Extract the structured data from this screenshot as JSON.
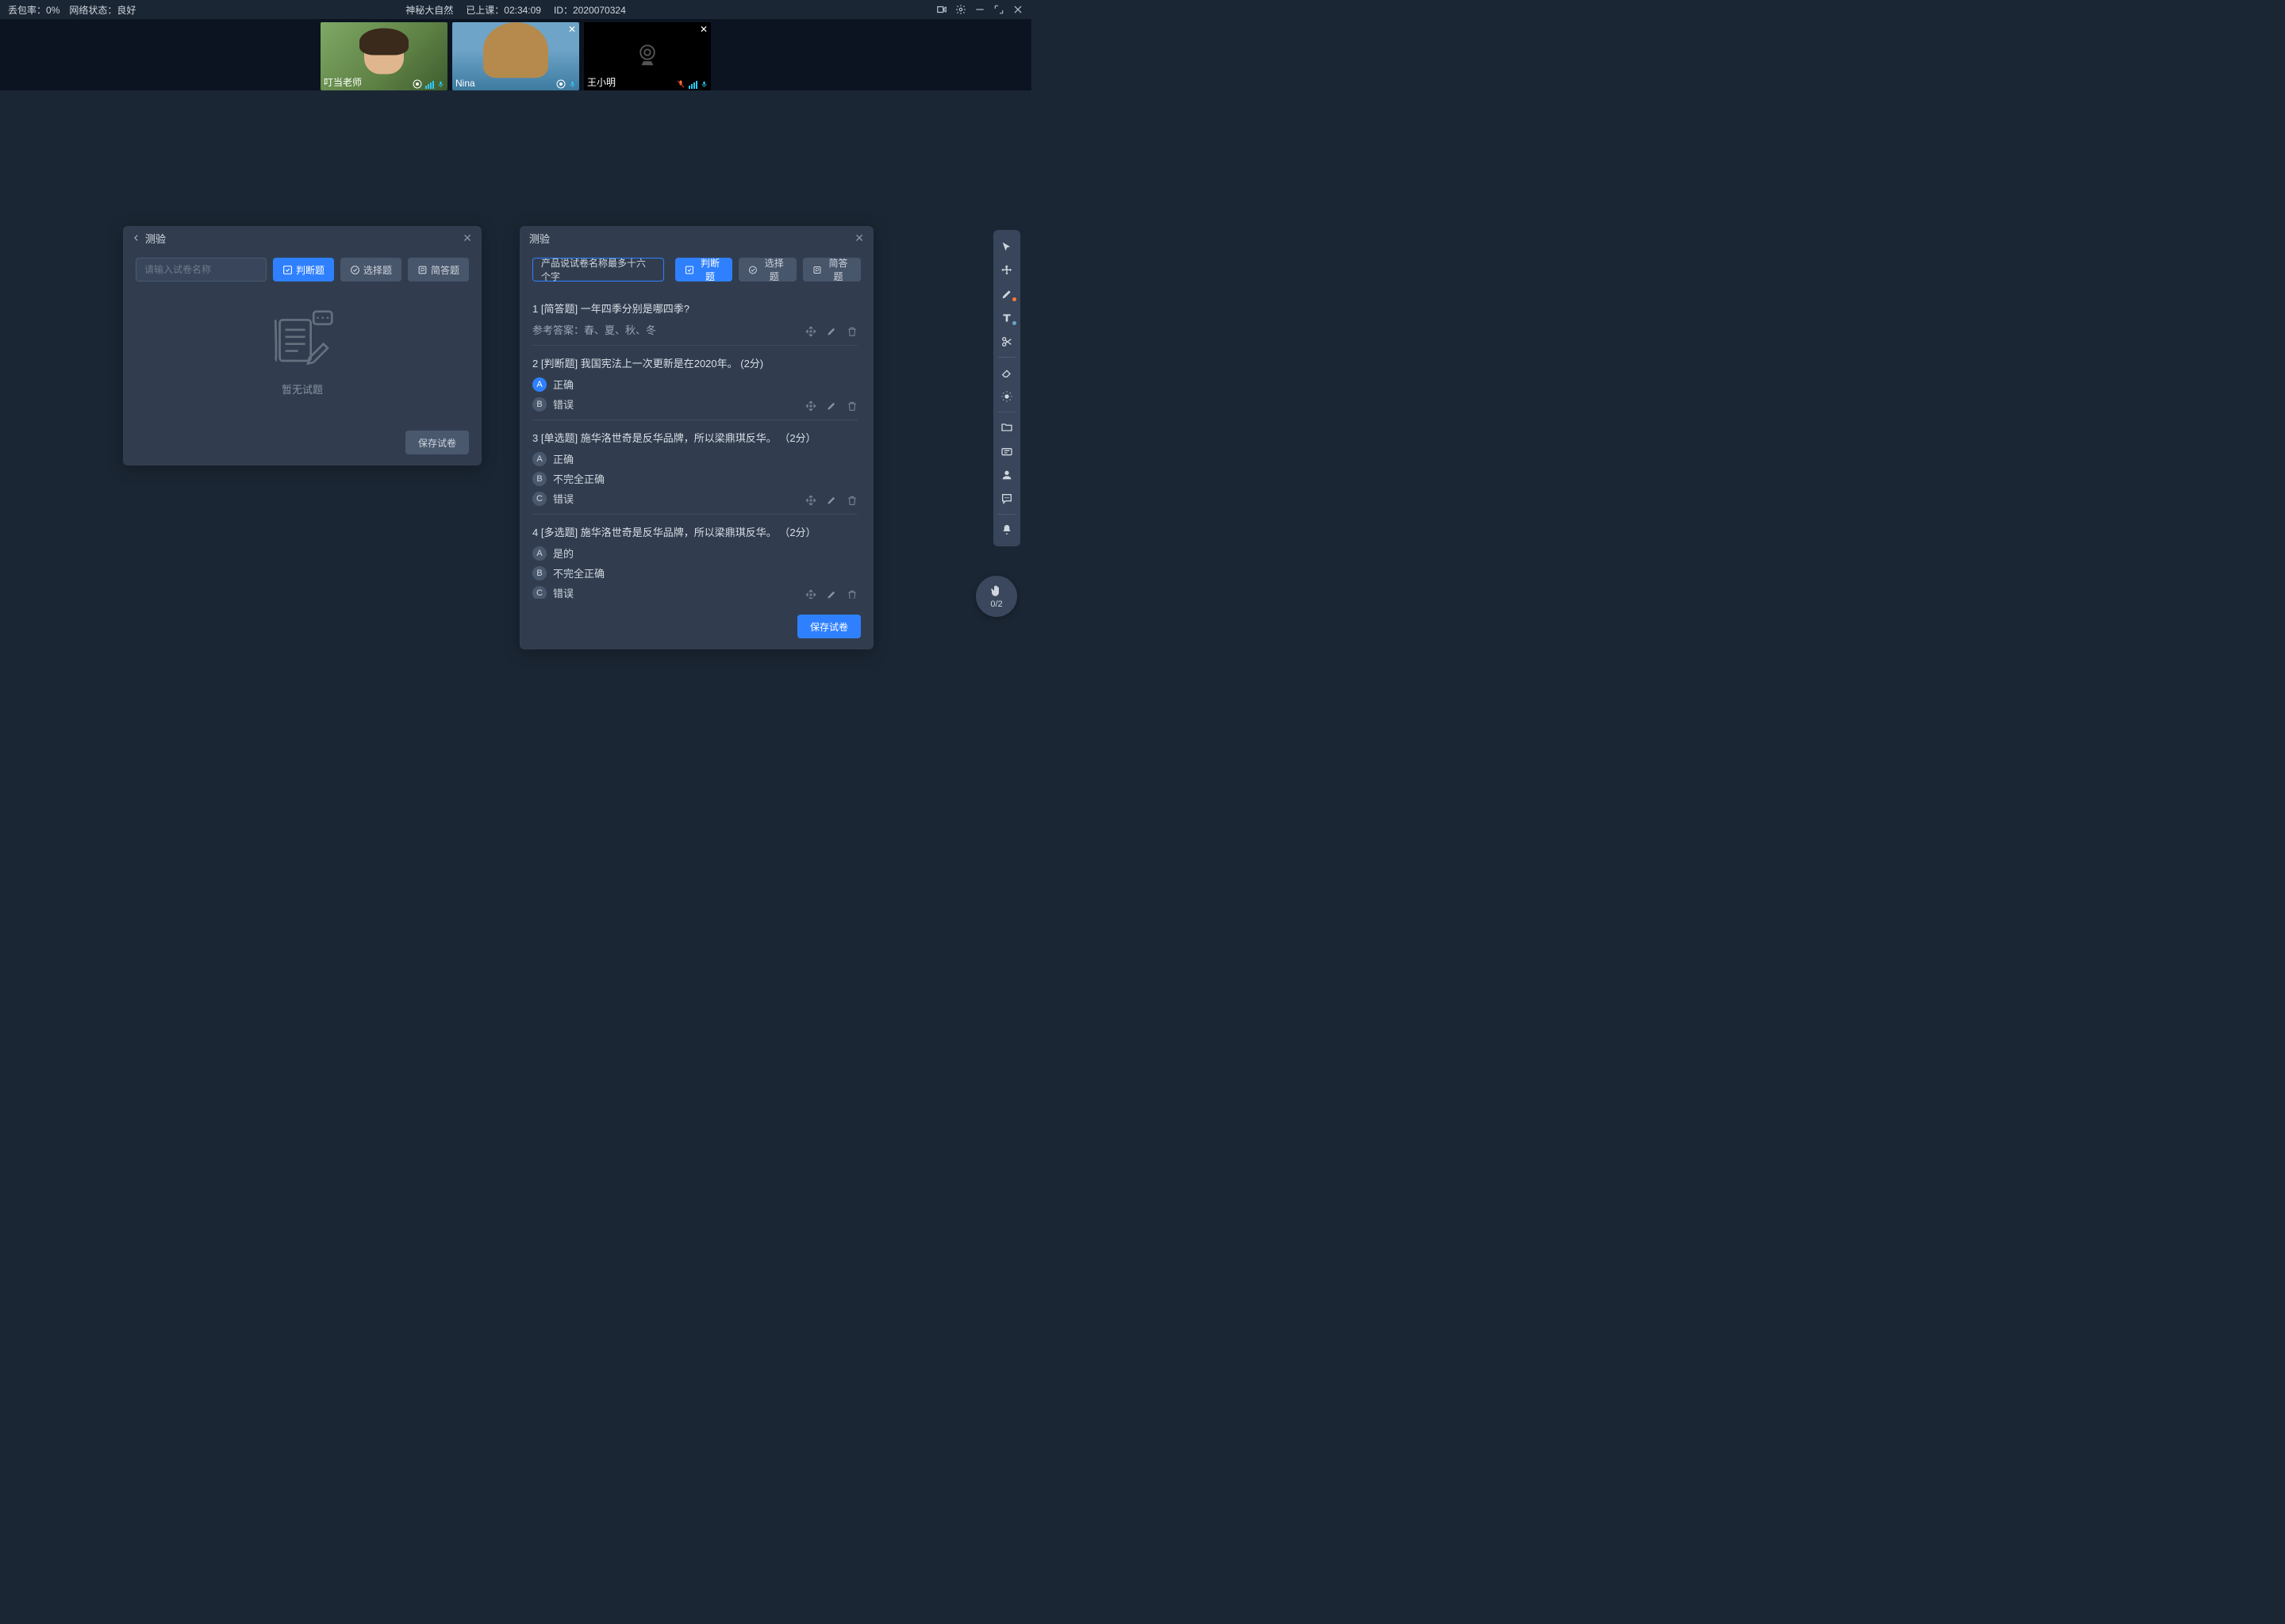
{
  "topbar": {
    "loss_label": "丢包率：",
    "loss_value": "0%",
    "net_label": "网络状态：",
    "net_value": "良好",
    "course_title": "神秘大自然",
    "elapsed_label": "已上课：",
    "elapsed_value": "02:34:09",
    "id_label": "ID：",
    "id_value": "2020070324"
  },
  "videos": [
    {
      "name": "叮当老师",
      "closeable": false,
      "mic_color": "#33c9ff"
    },
    {
      "name": "Nina",
      "closeable": true,
      "mic_color": "#33c9ff"
    },
    {
      "name": "王小明",
      "closeable": true,
      "mic_color": "#33c9ff",
      "mic_muted": true
    }
  ],
  "panel_left": {
    "title": "测验",
    "name_placeholder": "请输入试卷名称",
    "tabs": {
      "judge": "判断题",
      "choice": "选择题",
      "short": "简答题"
    },
    "empty": "暂无试题",
    "save": "保存试卷"
  },
  "panel_right": {
    "title": "测验",
    "name_value": "产品说试卷名称最多十六个字",
    "tabs": {
      "judge": "判断题",
      "choice": "选择题",
      "short": "简答题"
    },
    "save": "保存试卷",
    "answer_prefix": "参考答案：",
    "questions": [
      {
        "idx": "1",
        "type_tag": "[简答题]",
        "text": "一年四季分别是哪四季?",
        "answer": "春、夏、秋、冬"
      },
      {
        "idx": "2",
        "type_tag": "[判断题]",
        "text": "我国宪法上一次更新是在2020年。  (2分)",
        "choices": [
          {
            "letter": "A",
            "label": "正确",
            "selected": true
          },
          {
            "letter": "B",
            "label": "错误",
            "selected": false
          }
        ]
      },
      {
        "idx": "3",
        "type_tag": "[单选题]",
        "text": "施华洛世奇是反华品牌，所以梁鼎琪反华。 （2分）",
        "choices": [
          {
            "letter": "A",
            "label": "正确",
            "selected": false
          },
          {
            "letter": "B",
            "label": "不完全正确",
            "selected": false
          },
          {
            "letter": "C",
            "label": "错误",
            "selected": false
          }
        ]
      },
      {
        "idx": "4",
        "type_tag": "[多选题]",
        "text": "施华洛世奇是反华品牌，所以梁鼎琪反华。 （2分）",
        "choices": [
          {
            "letter": "A",
            "label": "是的",
            "selected": false
          },
          {
            "letter": "B",
            "label": "不完全正确",
            "selected": false
          },
          {
            "letter": "C",
            "label": "错误",
            "selected": false
          }
        ]
      }
    ]
  },
  "hand": {
    "count": "0/2"
  }
}
